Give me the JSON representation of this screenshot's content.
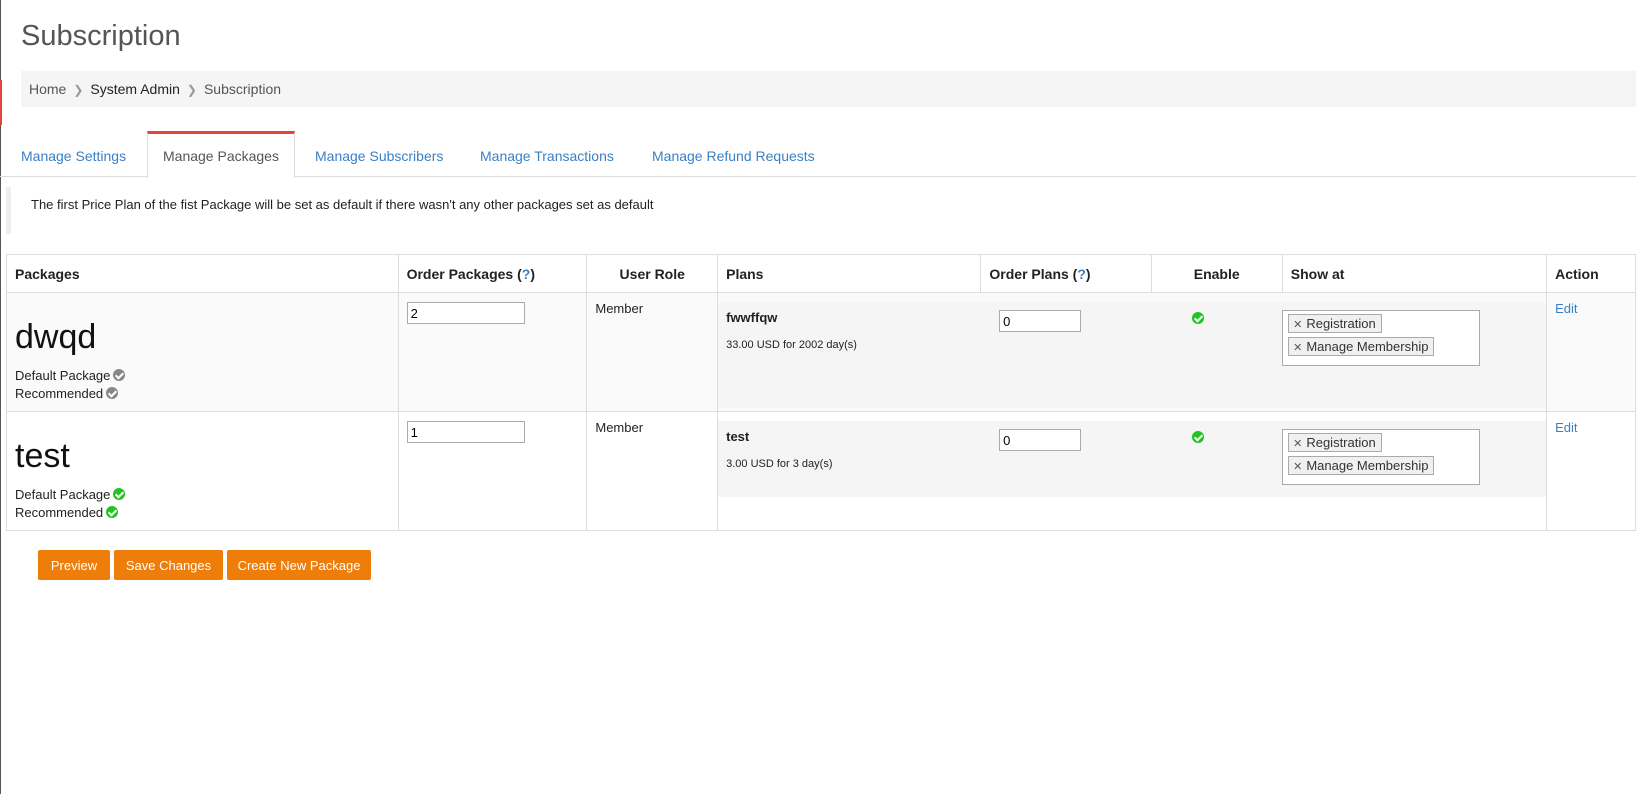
{
  "page": {
    "title": "Subscription"
  },
  "breadcrumb": [
    "Home",
    "System Admin",
    "Subscription"
  ],
  "tabs": [
    "Manage Settings",
    "Manage Packages",
    "Manage Subscribers",
    "Manage Transactions",
    "Manage Refund Requests"
  ],
  "notice": "The first Price Plan of the fist Package will be set as default if there wasn't any other packages set as default",
  "table": {
    "headers": {
      "packages": "Packages",
      "order_packages": "Order Packages (",
      "order_packages_q": "?",
      "order_packages_close": ")",
      "user_role": "User Role",
      "plans": "Plans",
      "order_plans": "Order Plans (",
      "order_plans_q": "?",
      "order_plans_close": ")",
      "enable": "Enable",
      "show_at": "Show at",
      "action": "Action"
    },
    "rows": [
      {
        "name": "dwqd",
        "default_label": "Default Package",
        "recommended_label": "Recommended",
        "default_status": "gray",
        "recommended_status": "gray",
        "order": "2",
        "role": "Member",
        "plan_name": "fwwffqw",
        "plan_price": "33.00 USD for 2002 day(s)",
        "plan_order": "0",
        "tags": [
          "Registration",
          "Manage Membership"
        ],
        "action": "Edit"
      },
      {
        "name": "test",
        "default_label": "Default Package",
        "recommended_label": "Recommended",
        "default_status": "green",
        "recommended_status": "green",
        "order": "1",
        "role": "Member",
        "plan_name": "test",
        "plan_price": "3.00 USD for 3 day(s)",
        "plan_order": "0",
        "tags": [
          "Registration",
          "Manage Membership"
        ],
        "action": "Edit"
      }
    ]
  },
  "buttons": {
    "preview": "Preview",
    "save": "Save Changes",
    "create": "Create New Package"
  },
  "colors": {
    "accent": "#ef7d0a",
    "link": "#3b7fc4",
    "active_tab": "#e8423b",
    "enabled": "#22c322"
  }
}
